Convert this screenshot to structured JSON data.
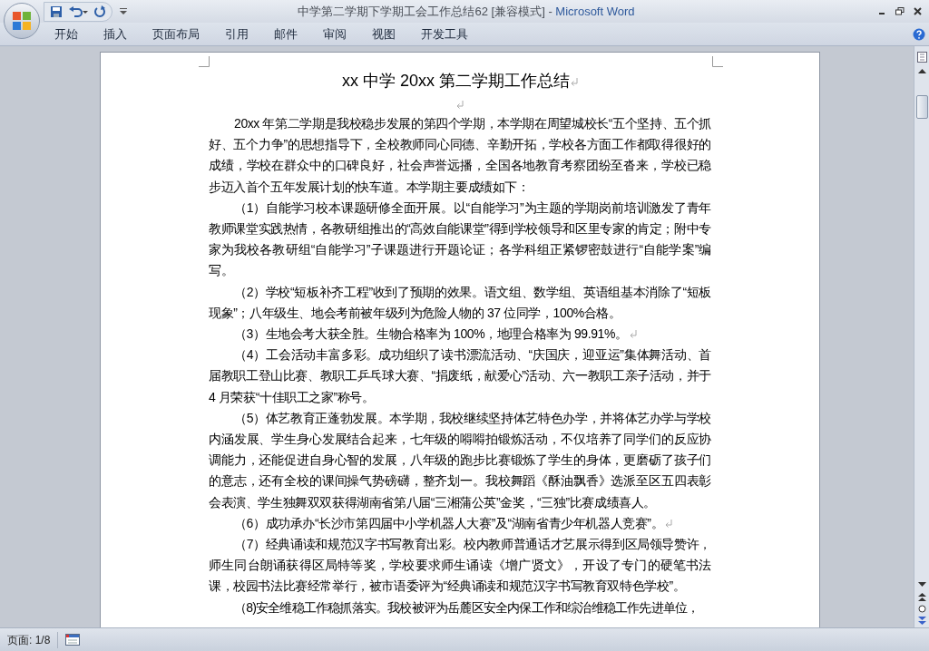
{
  "window": {
    "title": "中学第二学期下学期工会工作总结62 [兼容模式]",
    "separator": "-",
    "app": "Microsoft Word"
  },
  "ribbon_tabs": [
    {
      "label": "开始"
    },
    {
      "label": "插入"
    },
    {
      "label": "页面布局"
    },
    {
      "label": "引用"
    },
    {
      "label": "邮件"
    },
    {
      "label": "审阅"
    },
    {
      "label": "视图"
    },
    {
      "label": "开发工具"
    }
  ],
  "document": {
    "title": "xx 中学 20xx 第二学期工作总结",
    "paragraphs": [
      "20xx 年第二学期是我校稳步发展的第四个学期，本学期在周望城校长“五个坚持、五个抓好、五个力争”的思想指导下，全校教师同心同德、辛勤开拓，学校各方面工作都取得很好的成绩，学校在群众中的口碑良好，社会声誉远播，全国各地教育考察团纷至沓来，学校已稳步迈入首个五年发展计划的快车道。本学期主要成绩如下：",
      "（1）自能学习校本课题研修全面开展。以“自能学习”为主题的学期岗前培训激发了青年教师课堂实践热情，各教研组推出的“高效自能课堂”得到学校领导和区里专家的肯定；附中专家为我校各教研组“自能学习”子课题进行开题论证；各学科组正紧锣密鼓进行“自能学案”编写。",
      "（2）学校“短板补齐工程”收到了预期的效果。语文组、数学组、英语组基本消除了“短板现象”；八年级生、地会考前被年级列为危险人物的 37 位同学，100%合格。",
      "（3）生地会考大获全胜。生物合格率为 100%，地理合格率为 99.91%。",
      "（4）工会活动丰富多彩。成功组织了读书漂流活动、“庆国庆，迎亚运”集体舞活动、首届教职工登山比赛、教职工乒乓球大赛、“捐废纸，献爱心”活动、六一教职工亲子活动，并于 4 月荣获“十佳职工之家”称号。",
      "（5）体艺教育正蓬勃发展。本学期，我校继续坚持体艺特色办学，并将体艺办学与学校内涵发展、学生身心发展结合起来，七年级的嘚嘚拍锻炼活动，不仅培养了同学们的反应协调能力，还能促进自身心智的发展，八年级的跑步比赛锻炼了学生的身体，更磨砺了孩子们的意志，还有全校的课间操气势磅礴，整齐划一。我校舞蹈《酥油飘香》选派至区五四表彰会表演、学生独舞双双获得湖南省第八届“三湘蒲公英”金奖，“三独”比赛成绩喜人。",
      "（6）成功承办“长沙市第四届中小学机器人大赛”及“湖南省青少年机器人竞赛”。",
      "（7）经典诵读和规范汉字书写教育出彩。校内教师普通话才艺展示得到区局领导赞许，师生同台朗诵获得区局特等奖，学校要求师生诵读《增广贤文》，开设了专门的硬笔书法课，校园书法比赛经常举行，被市语委评为“经典诵读和规范汉字书写教育双特色学校”。",
      "（8)安全维稳工作稳抓落实。我校被评为岳麓区安全内保工作和综治维稳工作先进单位，"
    ]
  },
  "status_bar": {
    "page": "页面: 1/8"
  }
}
